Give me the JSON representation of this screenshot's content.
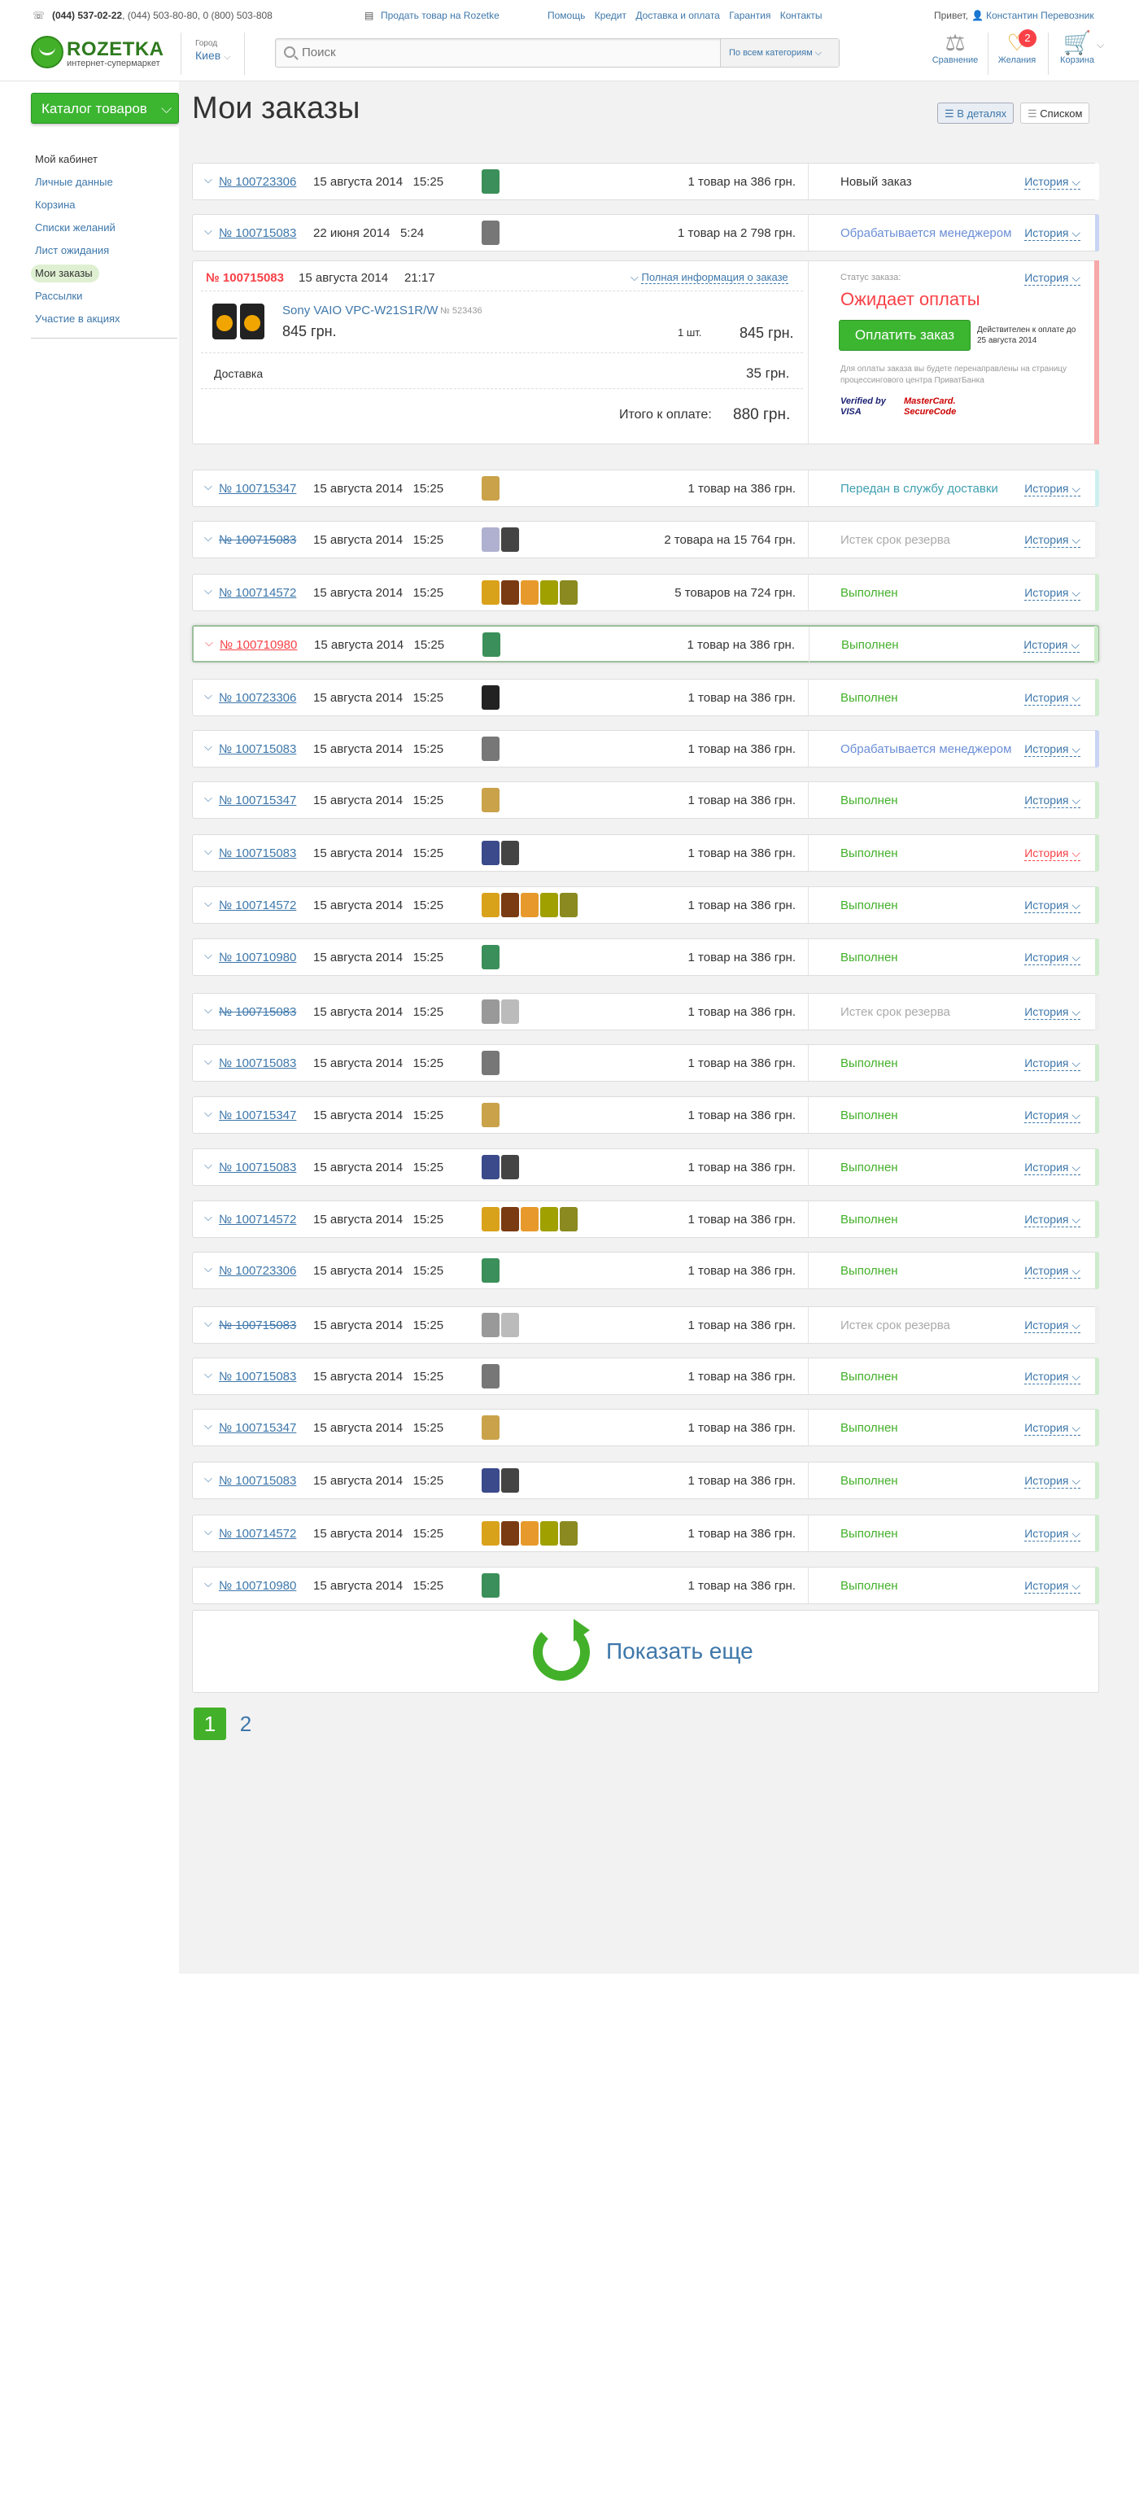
{
  "header": {
    "phones_main": "(044) 537-02-22",
    "phones_rest": ", (044) 503-80-80, 0 (800) 503-808",
    "sell_link": "Продать товар на Rozetke",
    "links": [
      "Помощь",
      "Кредит",
      "Доставка и оплата",
      "Гарантия",
      "Контакты"
    ],
    "greeting": "Привет,",
    "user_name": "Константин Перевозник",
    "logo_text": "ROZETKA",
    "logo_sub": "интернет-супермаркет",
    "city_label": "Город",
    "city": "Киев",
    "search_placeholder": "Поиск",
    "search_category": "По всем категориям",
    "compare_label": "Сравнение",
    "wishlist_label": "Желания",
    "wishlist_count": "2",
    "cart_label": "Корзина"
  },
  "sidebar": {
    "catalog_button": "Каталог товаров",
    "items": [
      "Мой кабинет",
      "Личные данные",
      "Корзина",
      "Списки желаний",
      "Лист ожидания",
      "Мои заказы",
      "Рассылки",
      "Участие в акциях"
    ]
  },
  "page": {
    "title": "Мои заказы",
    "view_details": "В деталях",
    "view_list": "Списком"
  },
  "expanded": {
    "number": "№ 100715083",
    "date": "15 августа 2014",
    "time": "21:17",
    "full_info": "Полная информация о заказе",
    "product_name": "Sony VAIO VPC-W21S1R/W",
    "product_code": "№ 523436",
    "product_price": "845 грн.",
    "product_qty": "1 шт.",
    "product_total": "845 грн.",
    "delivery_label": "Доставка",
    "delivery_price": "35 грн.",
    "total_label": "Итого к оплате:",
    "total_value": "880 грн.",
    "status_label": "Статус заказа:",
    "status": "Ожидает оплаты",
    "pay_button": "Оплатить заказ",
    "pay_valid": "Действителен к оплате до 25 августа 2014",
    "pay_note": "Для оплаты заказа вы будете перенаправлены на страницу процессингового центра ПриватБанка",
    "visa": "Verified by VISA",
    "mastercard": "MasterCard. SecureCode",
    "history": "История"
  },
  "orders": [
    {
      "number": "№ 100723306",
      "date": "15 августа 2014",
      "time": "15:25",
      "qty": "1 товар на 386 грн.",
      "status": "Новый заказ",
      "history": "История",
      "thumbs": [
        "#3b8f5a"
      ],
      "status_color": "#333",
      "bar": "#fff"
    },
    {
      "number": "№ 100715083",
      "date": "22 июня 2014",
      "time": "5:24",
      "qty": "1 товар на 2 798 грн.",
      "status": "Обрабатывается менеджером",
      "history": "История",
      "thumbs": [
        "#777"
      ],
      "status_color": "#6b8ed6",
      "bar": "#c9d4f5"
    },
    {
      "number": "№ 100715347",
      "date": "15 августа 2014",
      "time": "15:25",
      "qty": "1 товар на 386 грн.",
      "status": "Передан в службу доставки",
      "history": "История",
      "thumbs": [
        "#c9a24a"
      ],
      "status_color": "#3e9fb0",
      "bar": "#cdeff0"
    },
    {
      "number": "№ 100715083",
      "date": "15 августа 2014",
      "time": "15:25",
      "qty": "2 товара на 15 764 грн.",
      "status": "Истек срок резерва",
      "history": "История",
      "thumbs": [
        "#b0b0d0",
        "#444"
      ],
      "status_color": "#aaa",
      "bar": "#eee",
      "strike": true
    },
    {
      "number": "№ 100714572",
      "date": "15 августа 2014",
      "time": "15:25",
      "qty": "5 товаров на 724 грн.",
      "status": "Выполнен",
      "history": "История",
      "thumbs": [
        "#d9a21b",
        "#7a3b12",
        "#e79a2b",
        "#a0a000",
        "#8a8a20"
      ],
      "status_color": "#43b02a",
      "bar": "#cdeccb"
    },
    {
      "number": "№ 100710980",
      "date": "15 августа 2014",
      "time": "15:25",
      "qty": "1 товар на 386 грн.",
      "status": "Выполнен",
      "history": "История",
      "thumbs": [
        "#3b8f5a"
      ],
      "status_color": "#43b02a",
      "bar": "#cdeccb",
      "red": true,
      "sel": true
    },
    {
      "number": "№ 100723306",
      "date": "15 августа 2014",
      "time": "15:25",
      "qty": "1 товар на 386 грн.",
      "status": "Выполнен",
      "history": "История",
      "thumbs": [
        "#222"
      ],
      "status_color": "#43b02a",
      "bar": "#cdeccb"
    },
    {
      "number": "№ 100715083",
      "date": "15 августа 2014",
      "time": "15:25",
      "qty": "1 товар на 386 грн.",
      "status": "Обрабатывается менеджером",
      "history": "История",
      "thumbs": [
        "#777"
      ],
      "status_color": "#6b8ed6",
      "bar": "#c9d4f5"
    },
    {
      "number": "№ 100715347",
      "date": "15 августа 2014",
      "time": "15:25",
      "qty": "1 товар на 386 грн.",
      "status": "Выполнен",
      "history": "История",
      "thumbs": [
        "#c9a24a"
      ],
      "status_color": "#43b02a",
      "bar": "#cdeccb"
    },
    {
      "number": "№ 100715083",
      "date": "15 августа 2014",
      "time": "15:25",
      "qty": "1 товар на 386 грн.",
      "status": "Выполнен",
      "history": "История",
      "thumbs": [
        "#3a4a8a",
        "#444"
      ],
      "status_color": "#43b02a",
      "bar": "#cdeccb",
      "hist_red": true
    },
    {
      "number": "№ 100714572",
      "date": "15 августа 2014",
      "time": "15:25",
      "qty": "1 товар на 386 грн.",
      "status": "Выполнен",
      "history": "История",
      "thumbs": [
        "#d9a21b",
        "#7a3b12",
        "#e79a2b",
        "#a0a000",
        "#8a8a20"
      ],
      "status_color": "#43b02a",
      "bar": "#cdeccb"
    },
    {
      "number": "№ 100710980",
      "date": "15 августа 2014",
      "time": "15:25",
      "qty": "1 товар на 386 грн.",
      "status": "Выполнен",
      "history": "История",
      "thumbs": [
        "#3b8f5a"
      ],
      "status_color": "#43b02a",
      "bar": "#cdeccb"
    },
    {
      "number": "№ 100715083",
      "date": "15 августа 2014",
      "time": "15:25",
      "qty": "1 товар на 386 грн.",
      "status": "Истек срок резерва",
      "history": "История",
      "thumbs": [
        "#999",
        "#bbb"
      ],
      "status_color": "#aaa",
      "bar": "#eee",
      "strike": true
    },
    {
      "number": "№ 100715083",
      "date": "15 августа 2014",
      "time": "15:25",
      "qty": "1 товар на 386 грн.",
      "status": "Выполнен",
      "history": "История",
      "thumbs": [
        "#777"
      ],
      "status_color": "#43b02a",
      "bar": "#cdeccb"
    },
    {
      "number": "№ 100715347",
      "date": "15 августа 2014",
      "time": "15:25",
      "qty": "1 товар на 386 грн.",
      "status": "Выполнен",
      "history": "История",
      "thumbs": [
        "#c9a24a"
      ],
      "status_color": "#43b02a",
      "bar": "#cdeccb"
    },
    {
      "number": "№ 100715083",
      "date": "15 августа 2014",
      "time": "15:25",
      "qty": "1 товар на 386 грн.",
      "status": "Выполнен",
      "history": "История",
      "thumbs": [
        "#3a4a8a",
        "#444"
      ],
      "status_color": "#43b02a",
      "bar": "#cdeccb"
    },
    {
      "number": "№ 100714572",
      "date": "15 августа 2014",
      "time": "15:25",
      "qty": "1 товар на 386 грн.",
      "status": "Выполнен",
      "history": "История",
      "thumbs": [
        "#d9a21b",
        "#7a3b12",
        "#e79a2b",
        "#a0a000",
        "#8a8a20"
      ],
      "status_color": "#43b02a",
      "bar": "#cdeccb"
    },
    {
      "number": "№ 100723306",
      "date": "15 августа 2014",
      "time": "15:25",
      "qty": "1 товар на 386 грн.",
      "status": "Выполнен",
      "history": "История",
      "thumbs": [
        "#3b8f5a"
      ],
      "status_color": "#43b02a",
      "bar": "#cdeccb"
    },
    {
      "number": "№ 100715083",
      "date": "15 августа 2014",
      "time": "15:25",
      "qty": "1 товар на 386 грн.",
      "status": "Истек срок резерва",
      "history": "История",
      "thumbs": [
        "#999",
        "#bbb"
      ],
      "status_color": "#aaa",
      "bar": "#eee",
      "strike": true
    },
    {
      "number": "№ 100715083",
      "date": "15 августа 2014",
      "time": "15:25",
      "qty": "1 товар на 386 грн.",
      "status": "Выполнен",
      "history": "История",
      "thumbs": [
        "#777"
      ],
      "status_color": "#43b02a",
      "bar": "#cdeccb"
    },
    {
      "number": "№ 100715347",
      "date": "15 августа 2014",
      "time": "15:25",
      "qty": "1 товар на 386 грн.",
      "status": "Выполнен",
      "history": "История",
      "thumbs": [
        "#c9a24a"
      ],
      "status_color": "#43b02a",
      "bar": "#cdeccb"
    },
    {
      "number": "№ 100715083",
      "date": "15 августа 2014",
      "time": "15:25",
      "qty": "1 товар на 386 грн.",
      "status": "Выполнен",
      "history": "История",
      "thumbs": [
        "#3a4a8a",
        "#444"
      ],
      "status_color": "#43b02a",
      "bar": "#cdeccb"
    },
    {
      "number": "№ 100714572",
      "date": "15 августа 2014",
      "time": "15:25",
      "qty": "1 товар на 386 грн.",
      "status": "Выполнен",
      "history": "История",
      "thumbs": [
        "#d9a21b",
        "#7a3b12",
        "#e79a2b",
        "#a0a000",
        "#8a8a20"
      ],
      "status_color": "#43b02a",
      "bar": "#cdeccb"
    },
    {
      "number": "№ 100710980",
      "date": "15 августа 2014",
      "time": "15:25",
      "qty": "1 товар на 386 грн.",
      "status": "Выполнен",
      "history": "История",
      "thumbs": [
        "#3b8f5a"
      ],
      "status_color": "#43b02a",
      "bar": "#cdeccb"
    }
  ],
  "more": {
    "label": "Показать еще"
  },
  "pagination": [
    "1",
    "2"
  ]
}
